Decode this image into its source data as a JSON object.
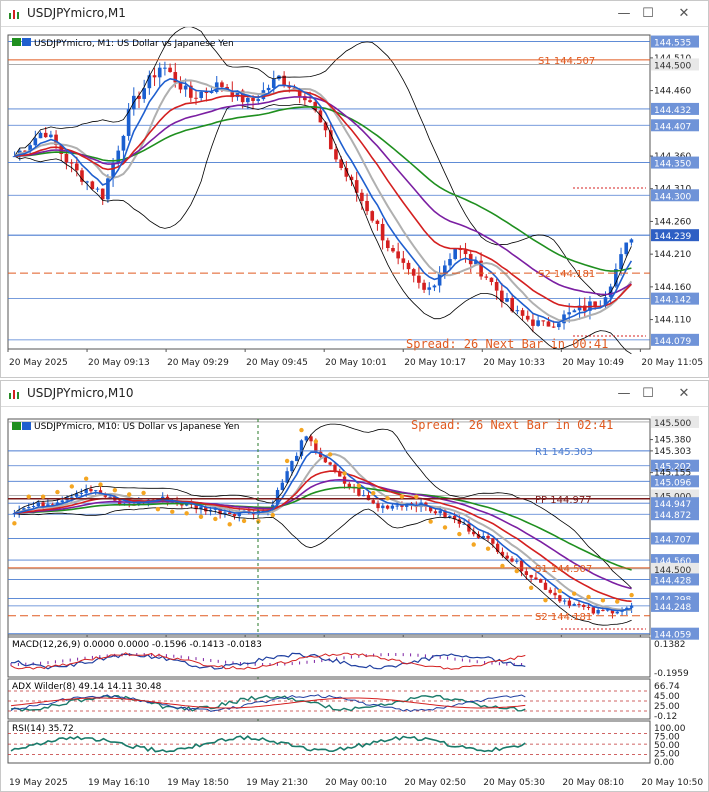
{
  "colors": {
    "blue_line": "#1f5fcf",
    "red_line": "#d42020",
    "purple_line": "#7b1fa2",
    "green_line": "#1f8f1f",
    "grey_line": "#b0b0b0",
    "orange": "#f4a622",
    "grid_blue": "#4a7bd0",
    "axis_text": "#222"
  },
  "windows": [
    {
      "title": "USDJPYmicro,M1",
      "legend": "USDJPYmicro, M1:  US Dollar vs Japanese Yen",
      "spread_text": "Spread: 26  Next Bar in 00:41",
      "price_labels": [
        {
          "text": "144.535",
          "highlight": true
        },
        {
          "text": "144.510",
          "highlight": false
        },
        {
          "text": "144.500",
          "highlight": true,
          "grey": true
        },
        {
          "text": "144.460",
          "highlight": false
        },
        {
          "text": "144.432",
          "highlight": true
        },
        {
          "text": "144.407",
          "highlight": true
        },
        {
          "text": "144.360",
          "highlight": false
        },
        {
          "text": "144.350",
          "highlight": true
        },
        {
          "text": "144.310",
          "highlight": false
        },
        {
          "text": "144.300",
          "highlight": true
        },
        {
          "text": "144.260",
          "highlight": false
        },
        {
          "text": "144.239",
          "highlight": true,
          "dark": true
        },
        {
          "text": "144.210",
          "highlight": false
        },
        {
          "text": "144.160",
          "highlight": false
        },
        {
          "text": "144.142",
          "highlight": true
        },
        {
          "text": "144.110",
          "highlight": false
        },
        {
          "text": "144.079",
          "highlight": true
        }
      ],
      "levels": [
        {
          "text": "S1 144.507"
        },
        {
          "text": "S2 144.181"
        }
      ],
      "time_labels": [
        "20 May 2025",
        "20 May 09:13",
        "20 May 09:29",
        "20 May 09:45",
        "20 May 10:01",
        "20 May 10:17",
        "20 May 10:33",
        "20 May 10:49",
        "20 May 11:05"
      ]
    },
    {
      "title": "USDJPYmicro,M10",
      "legend": "USDJPYmicro, M10:  US Dollar vs Japanese Yen",
      "spread_text": "Spread: 26  Next Bar in 02:41",
      "price_labels": [
        {
          "text": "145.500",
          "highlight": true,
          "grey": true
        },
        {
          "text": "145.380",
          "highlight": false
        },
        {
          "text": "145.303",
          "highlight": false
        },
        {
          "text": "145.202",
          "highlight": true
        },
        {
          "text": "145.155",
          "highlight": false
        },
        {
          "text": "145.096",
          "highlight": true
        },
        {
          "text": "145.000",
          "highlight": true,
          "grey": true
        },
        {
          "text": "144.947",
          "highlight": true
        },
        {
          "text": "144.872",
          "highlight": true
        },
        {
          "text": "144.707",
          "highlight": true
        },
        {
          "text": "144.560",
          "highlight": true
        },
        {
          "text": "144.500",
          "highlight": true,
          "grey": true
        },
        {
          "text": "144.428",
          "highlight": true
        },
        {
          "text": "144.298",
          "highlight": true
        },
        {
          "text": "144.248",
          "highlight": true
        },
        {
          "text": "144.059",
          "highlight": true
        }
      ],
      "levels": [
        {
          "text": "R1 145.303"
        },
        {
          "text": "PP 144.977"
        },
        {
          "text": "S1 144.507"
        },
        {
          "text": "S2 144.181"
        }
      ],
      "macd": {
        "label": "MACD(12,26,9) 0.0000 0.0000 -0.1596 -0.1413 -0.0183",
        "scale_top": "0.1382",
        "scale_bottom": "-0.1959"
      },
      "adx": {
        "label": "ADX Wilder(8) 49.14 14.11 30.48",
        "scale": [
          "66.74",
          "45.00",
          "25.00",
          "-0.12"
        ]
      },
      "rsi": {
        "label": "RSI(14) 35.72",
        "scale": [
          "100.00",
          "75.00",
          "50.00",
          "25.00",
          "0.00"
        ]
      },
      "time_labels": [
        "19 May 2025",
        "19 May 16:10",
        "19 May 18:50",
        "19 May 21:30",
        "20 May 00:10",
        "20 May 02:50",
        "20 May 05:30",
        "20 May 08:10",
        "20 May 10:50"
      ]
    }
  ],
  "chart_data": [
    {
      "type": "candlestick",
      "title": "USDJPYmicro, M1: US Dollar vs Japanese Yen",
      "ylim": [
        144.065,
        144.545
      ],
      "x": [
        "20 May 2025",
        "20 May 09:13",
        "20 May 09:29",
        "20 May 09:45",
        "20 May 10:01",
        "20 May 10:17",
        "20 May 10:33",
        "20 May 10:49",
        "20 May 11:05"
      ],
      "close_path": [
        144.36,
        144.4,
        144.34,
        144.3,
        144.44,
        144.5,
        144.45,
        144.47,
        144.44,
        144.48,
        144.45,
        144.35,
        144.28,
        144.2,
        144.15,
        144.22,
        144.18,
        144.12,
        144.1,
        144.12,
        144.14,
        144.239
      ],
      "levels": {
        "S1": 144.507,
        "S2": 144.181
      }
    },
    {
      "type": "candlestick",
      "title": "USDJPYmicro, M10: US Dollar vs Japanese Yen",
      "ylim": [
        144.05,
        145.52
      ],
      "x": [
        "19 May 2025",
        "19 May 16:10",
        "19 May 18:50",
        "19 May 21:30",
        "20 May 00:10",
        "20 May 02:50",
        "20 May 05:30",
        "20 May 08:10",
        "20 May 10:50"
      ],
      "close_path": [
        144.9,
        144.95,
        145.05,
        144.93,
        144.98,
        144.92,
        144.88,
        144.9,
        145.4,
        145.1,
        144.92,
        144.95,
        144.85,
        144.7,
        144.5,
        144.3,
        144.2,
        144.24
      ],
      "levels": {
        "R1": 145.303,
        "PP": 144.977,
        "S1": 144.507,
        "S2": 144.181
      }
    }
  ]
}
